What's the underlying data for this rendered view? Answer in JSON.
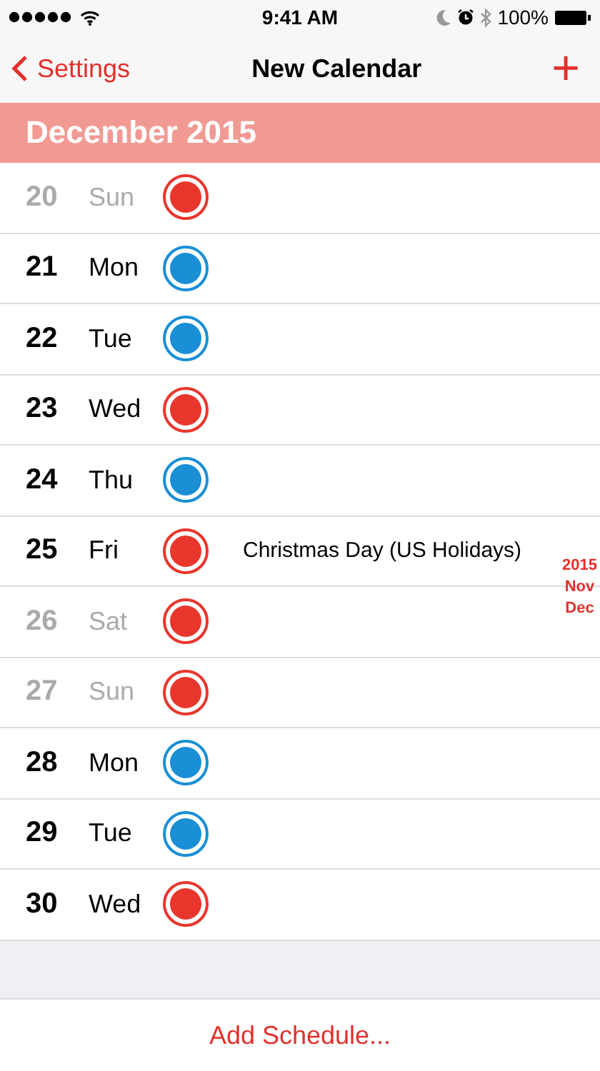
{
  "status_bar": {
    "time": "9:41 AM",
    "battery": "100%"
  },
  "nav": {
    "back": "Settings",
    "title": "New Calendar",
    "add": "+"
  },
  "month_header": "December 2015",
  "days": [
    {
      "day": "20",
      "weekday": "Sun",
      "weekend": true,
      "color": "#e8362d"
    },
    {
      "day": "21",
      "weekday": "Mon",
      "weekend": false,
      "color": "#1a8fd6"
    },
    {
      "day": "22",
      "weekday": "Tue",
      "weekend": false,
      "color": "#1a8fd6"
    },
    {
      "day": "23",
      "weekday": "Wed",
      "weekend": false,
      "color": "#e8362d"
    },
    {
      "day": "24",
      "weekday": "Thu",
      "weekend": false,
      "color": "#1a8fd6"
    },
    {
      "day": "25",
      "weekday": "Fri",
      "weekend": false,
      "color": "#e8362d",
      "event": "Christmas Day (US Holidays)"
    },
    {
      "day": "26",
      "weekday": "Sat",
      "weekend": true,
      "color": "#e8362d"
    },
    {
      "day": "27",
      "weekday": "Sun",
      "weekend": true,
      "color": "#e8362d"
    },
    {
      "day": "28",
      "weekday": "Mon",
      "weekend": false,
      "color": "#1a8fd6"
    },
    {
      "day": "29",
      "weekday": "Tue",
      "weekend": false,
      "color": "#1a8fd6"
    },
    {
      "day": "30",
      "weekday": "Wed",
      "weekend": false,
      "color": "#e8362d"
    }
  ],
  "index": [
    "2015",
    "Nov",
    "Dec"
  ],
  "footer_button": "Add Schedule..."
}
